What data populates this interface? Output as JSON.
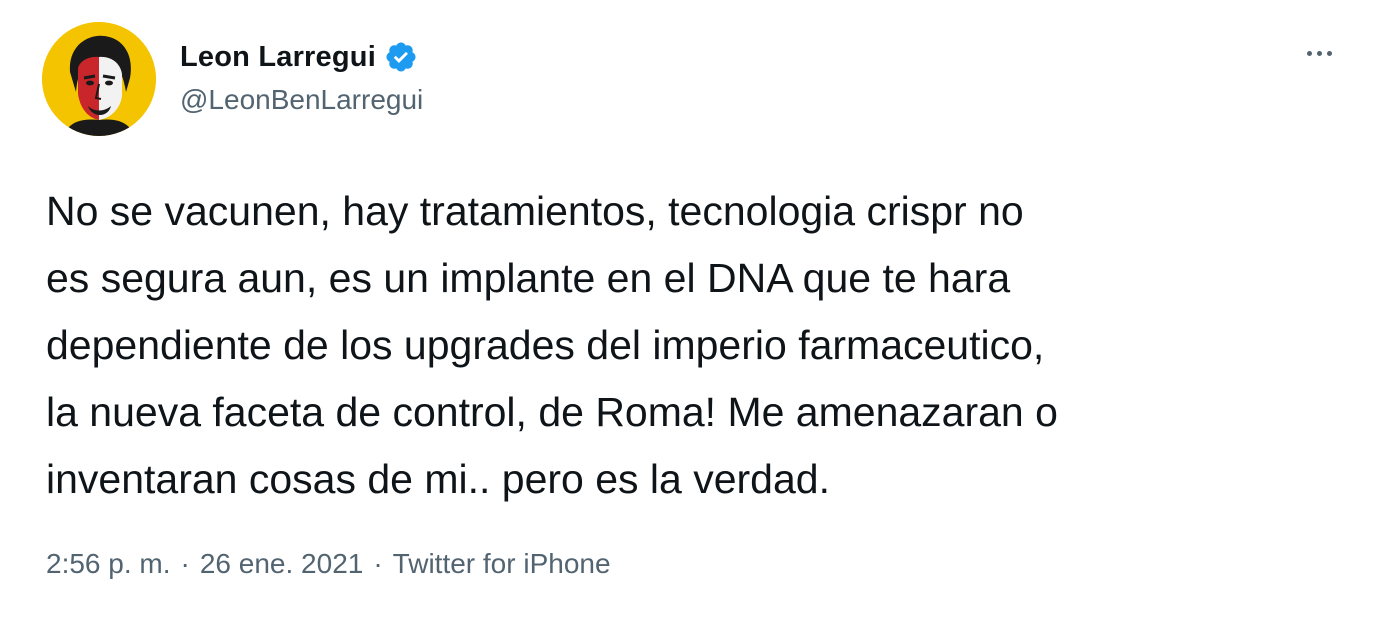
{
  "tweet": {
    "author": {
      "display_name": "Leon Larregui",
      "handle": "@LeonBenLarregui",
      "verified": true,
      "avatar_icon": "profile-portrait-icon",
      "avatar_bg": "#f5c400"
    },
    "text": "No se vacunen, hay tratamientos, tecnologia crispr no\nes segura aun, es un implante en el DNA que te hara\ndependiente de los upgrades del imperio farmaceutico,\nla nueva faceta de control, de Roma! Me amenazaran o\ninventaran cosas de mi.. pero es la verdad.",
    "time": "2:56 p. m.",
    "separator": "·",
    "date": "26 ene. 2021",
    "source": "Twitter for iPhone",
    "more_icon": "more-options-icon"
  },
  "colors": {
    "verified_badge": "#1d9bf0",
    "secondary_text": "#536471",
    "primary_text": "#0f1419"
  }
}
